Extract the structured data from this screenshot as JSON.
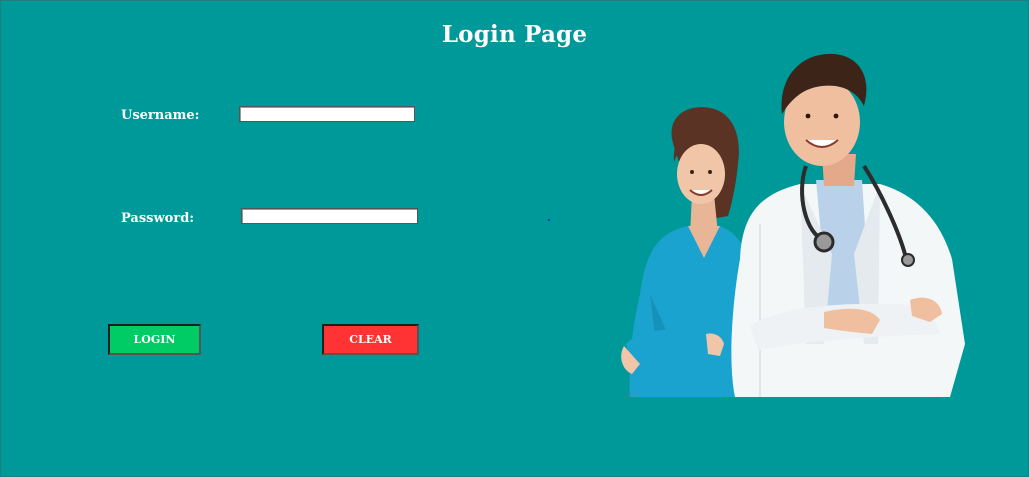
{
  "page": {
    "title": "Login Page",
    "background_color": "#009999"
  },
  "form": {
    "username_label": "Username:",
    "username_value": "",
    "password_label": "Password:",
    "password_value": "",
    "login_label": "LOGIN",
    "clear_label": "CLEAR"
  },
  "colors": {
    "login_button": "#00cc66",
    "clear_button": "#ff3333"
  },
  "image": {
    "name": "doctor-and-nurse-photo"
  }
}
